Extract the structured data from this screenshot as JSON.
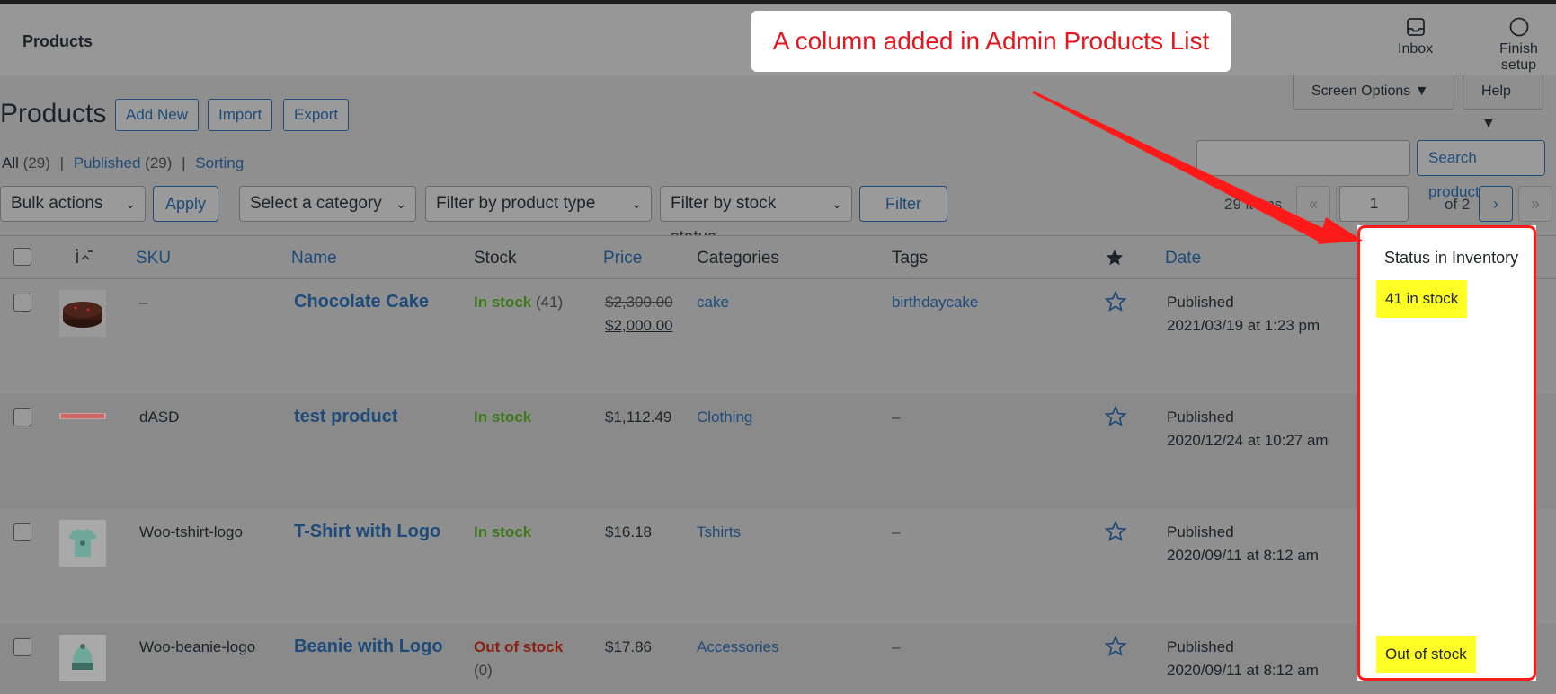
{
  "header": {
    "title": "Products",
    "inbox_label": "Inbox",
    "finish_label": "Finish setup"
  },
  "screen": {
    "screen_options": "Screen Options ▼",
    "help": "Help ▼"
  },
  "page": {
    "title": "Products",
    "buttons": [
      "Add New",
      "Import",
      "Export"
    ]
  },
  "subsubsub": {
    "all": "All",
    "all_count": "(29)",
    "published": "Published",
    "published_count": "(29)",
    "sorting": "Sorting",
    "sep": "|"
  },
  "search": {
    "placeholder": "",
    "button": "Search products"
  },
  "filters": {
    "bulk_actions": "Bulk actions",
    "apply": "Apply",
    "category": "Select a category",
    "product_type": "Filter by product type",
    "stock_status": "Filter by stock status",
    "filter": "Filter"
  },
  "pagination": {
    "items": "29 items",
    "first": "«",
    "prev": "‹",
    "current": "1",
    "of": "of 2",
    "next": "›",
    "last": "»"
  },
  "table": {
    "headers": {
      "sku": "SKU",
      "name": "Name",
      "stock": "Stock",
      "price": "Price",
      "categories": "Categories",
      "tags": "Tags",
      "date": "Date",
      "inventory": "Status in Inventory",
      "featured_icon": "star-filled-icon",
      "image_icon": "image-icon"
    },
    "rows": [
      {
        "sku": "–",
        "name": "Chocolate Cake",
        "stock_label": "In stock",
        "stock_count": "(41)",
        "price_old": "$2,300.00",
        "price_new": "$2,000.00",
        "category": "cake",
        "tags": "birthdaycake",
        "date_status": "Published",
        "date": "2021/03/19 at 1:23 pm",
        "inventory": "41 in stock"
      },
      {
        "sku": "dASD",
        "name": "test product",
        "stock_label": "In stock",
        "stock_count": "",
        "price_old": "",
        "price_new": "$1,112.49",
        "category": "Clothing",
        "tags": "–",
        "date_status": "Published",
        "date": "2020/12/24 at 10:27 am",
        "inventory": ""
      },
      {
        "sku": "Woo-tshirt-logo",
        "name": "T-Shirt with Logo",
        "stock_label": "In stock",
        "stock_count": "",
        "price_old": "",
        "price_new": "$16.18",
        "category": "Tshirts",
        "tags": "–",
        "date_status": "Published",
        "date": "2020/09/11 at 8:12 am",
        "inventory": ""
      },
      {
        "sku": "Woo-beanie-logo",
        "name": "Beanie with Logo",
        "stock_label": "Out of stock",
        "stock_count": "(0)",
        "price_old": "",
        "price_new": "$17.86",
        "category": "Accessories",
        "tags": "–",
        "date_status": "Published",
        "date": "2020/09/11 at 8:12 am",
        "inventory": "Out of stock"
      }
    ]
  },
  "annotation": {
    "text": "A column added in Admin Products List",
    "color": "#e8141c"
  }
}
